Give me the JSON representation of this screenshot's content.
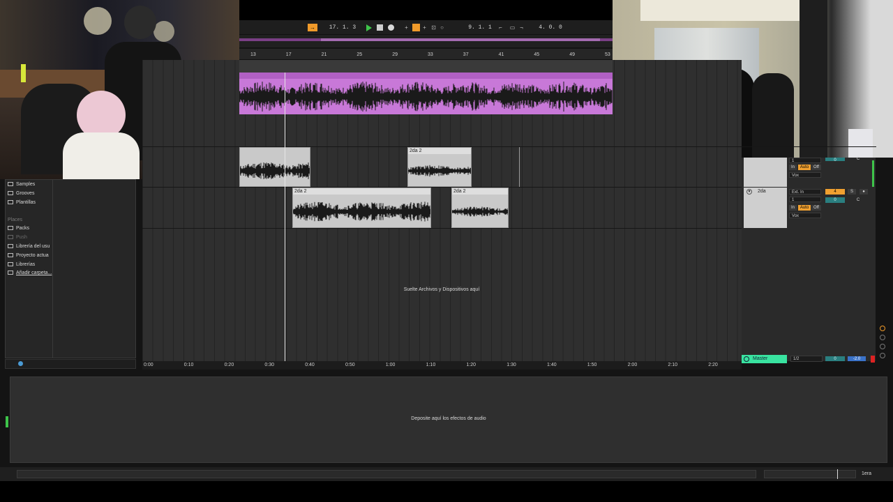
{
  "transport": {
    "position": "17.  1.  3",
    "loop_start": "9.  1.  1",
    "loop_length": "4.  0.  0"
  },
  "beat_ruler": [
    "13",
    "17",
    "21",
    "25",
    "29",
    "33",
    "37",
    "41",
    "45",
    "49",
    "53"
  ],
  "time_ruler": [
    "0:00",
    "0:10",
    "0:20",
    "0:30",
    "0:40",
    "0:50",
    "1:00",
    "1:10",
    "1:20",
    "1:30",
    "1:40",
    "1:50",
    "2:00",
    "2:10",
    "2:20"
  ],
  "browser": {
    "items": [
      "Samples",
      "Grooves",
      "Plantillas"
    ],
    "places_header": "Places",
    "places": [
      "Packs",
      "Push",
      "Librería del usu",
      "Proyecto actua",
      "Librerías",
      "Añadir carpeta..."
    ]
  },
  "clips": {
    "a": "2da 2",
    "b": "2da 2",
    "c": "2da 2"
  },
  "arrangement": {
    "drop_hint": "Suelte Archivos y Dispositivos aquí"
  },
  "mixer": {
    "track1": {
      "monitor_in": "In",
      "monitor_auto": "Auto",
      "monitor_off": "Off",
      "output": "Vox",
      "channel": "1",
      "volume": "0",
      "pan": "C"
    },
    "track2": {
      "name": "2da",
      "input_type": "Ext. In",
      "channel": "1",
      "monitor_in": "In",
      "monitor_auto": "Auto",
      "monitor_off": "Off",
      "output": "Vox",
      "track_number": "4",
      "solo": "S",
      "volume": "0",
      "pan": "C"
    },
    "master": {
      "name": "Master",
      "output": "1/2",
      "volume": "0",
      "peak": "-2.0"
    }
  },
  "device_panel": {
    "hint": "Deposite aquí los efectos de audio"
  },
  "status": {
    "track_label": "1era"
  },
  "colors": {
    "purple_clip": "#c878d8",
    "orange_accent": "#f0a030",
    "master_green": "#39e3a0",
    "play_green": "#3ec44a"
  }
}
